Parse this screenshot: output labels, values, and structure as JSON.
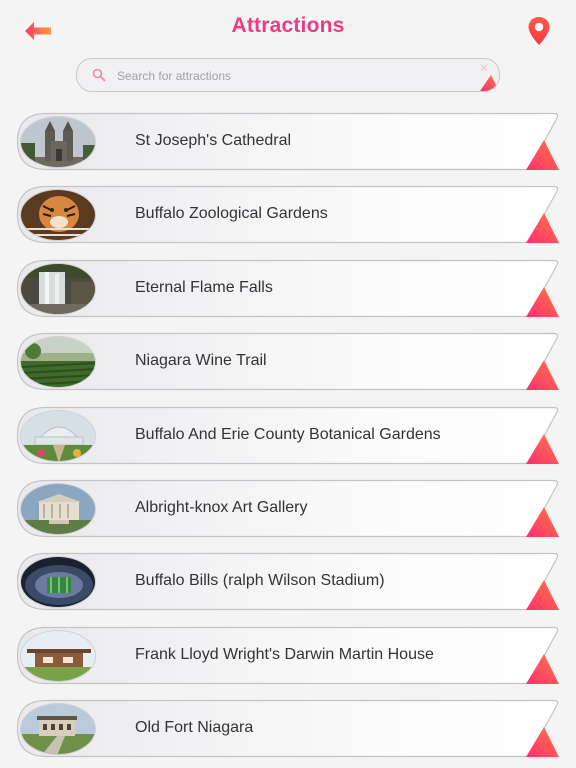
{
  "header": {
    "title": "Attractions",
    "back_icon": "arrow-left-icon",
    "map_icon": "map-pin-icon"
  },
  "search": {
    "placeholder": "Search for attractions",
    "value": "",
    "clear_symbol": "✕"
  },
  "attractions": [
    {
      "name": "St Joseph's Cathedral",
      "thumb": "cathedral"
    },
    {
      "name": "Buffalo Zoological Gardens",
      "thumb": "tiger"
    },
    {
      "name": "Eternal Flame Falls",
      "thumb": "waterfall"
    },
    {
      "name": "Niagara Wine Trail",
      "thumb": "vineyard"
    },
    {
      "name": "Buffalo And Erie County Botanical Gardens",
      "thumb": "conservatory"
    },
    {
      "name": "Albright-knox Art Gallery",
      "thumb": "gallery"
    },
    {
      "name": "Buffalo Bills (ralph Wilson Stadium)",
      "thumb": "stadium"
    },
    {
      "name": "Frank Lloyd Wright's Darwin Martin House",
      "thumb": "prairie-house"
    },
    {
      "name": "Old Fort Niagara",
      "thumb": "fort"
    }
  ],
  "colors": {
    "accent": "#ee3b86",
    "accent_orange": "#f26a3a",
    "gradient_start": "#fd3a6e",
    "gradient_end": "#ff7a45"
  }
}
